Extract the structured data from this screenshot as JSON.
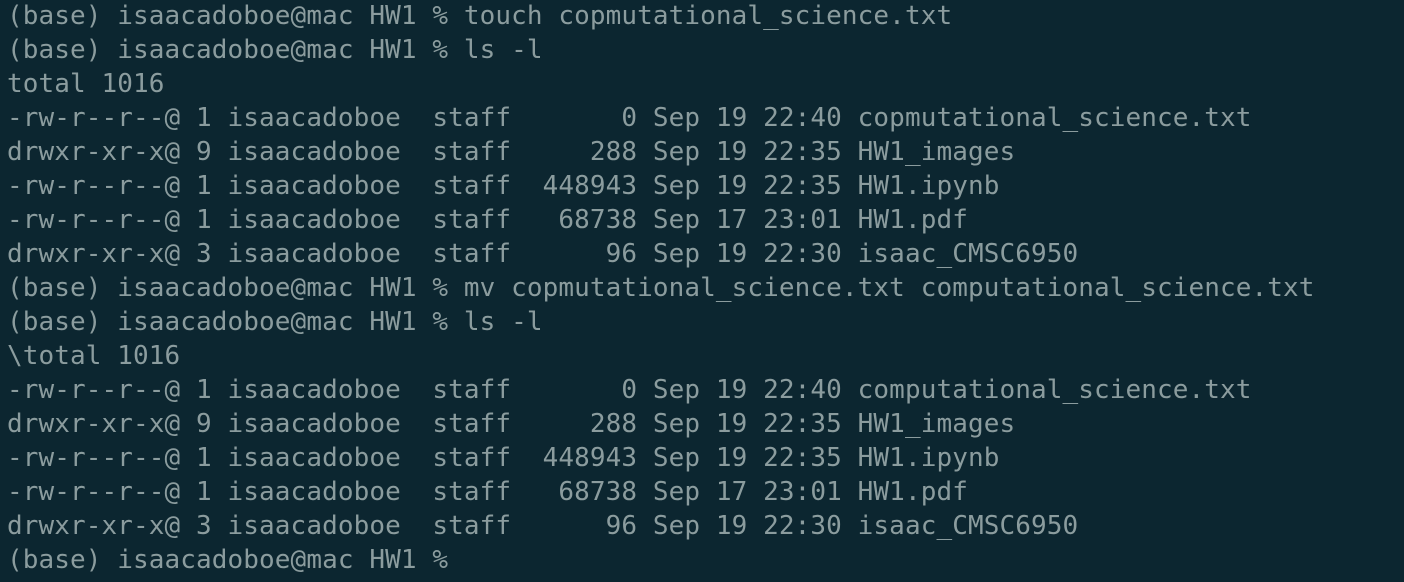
{
  "terminal": {
    "lines": [
      "(base) isaacadoboe@mac HW1 % touch copmutational_science.txt",
      "(base) isaacadoboe@mac HW1 % ls -l",
      "total 1016",
      "-rw-r--r--@ 1 isaacadoboe  staff       0 Sep 19 22:40 copmutational_science.txt",
      "drwxr-xr-x@ 9 isaacadoboe  staff     288 Sep 19 22:35 HW1_images",
      "-rw-r--r--@ 1 isaacadoboe  staff  448943 Sep 19 22:35 HW1.ipynb",
      "-rw-r--r--@ 1 isaacadoboe  staff   68738 Sep 17 23:01 HW1.pdf",
      "drwxr-xr-x@ 3 isaacadoboe  staff      96 Sep 19 22:30 isaac_CMSC6950",
      "(base) isaacadoboe@mac HW1 % mv copmutational_science.txt computational_science.txt",
      "(base) isaacadoboe@mac HW1 % ls -l",
      "\\total 1016",
      "-rw-r--r--@ 1 isaacadoboe  staff       0 Sep 19 22:40 computational_science.txt",
      "drwxr-xr-x@ 9 isaacadoboe  staff     288 Sep 19 22:35 HW1_images",
      "-rw-r--r--@ 1 isaacadoboe  staff  448943 Sep 19 22:35 HW1.ipynb",
      "-rw-r--r--@ 1 isaacadoboe  staff   68738 Sep 17 23:01 HW1.pdf",
      "drwxr-xr-x@ 3 isaacadoboe  staff      96 Sep 19 22:30 isaac_CMSC6950",
      "(base) isaacadoboe@mac HW1 % "
    ]
  },
  "colors": {
    "background": "#0c2630",
    "foreground": "#8b9c9e"
  }
}
